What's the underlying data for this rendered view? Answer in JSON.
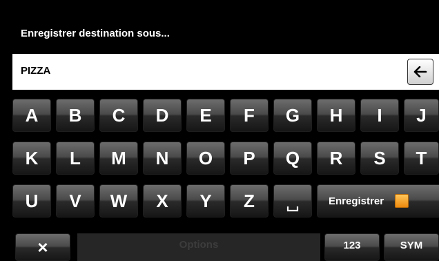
{
  "header": {
    "title": "Enregistrer destination sous..."
  },
  "input": {
    "value": "PIZZA",
    "backspace_icon": "arrow-left-icon"
  },
  "keyboard": {
    "row1": [
      "A",
      "B",
      "C",
      "D",
      "E",
      "F",
      "G",
      "H",
      "I",
      "J"
    ],
    "row2": [
      "K",
      "L",
      "M",
      "N",
      "O",
      "P",
      "Q",
      "R",
      "S",
      "T"
    ],
    "row3": [
      "U",
      "V",
      "W",
      "X",
      "Y",
      "Z"
    ],
    "space_key_icon": "space-bar-icon",
    "save_label": "Enregistrer",
    "save_icon": "save-icon"
  },
  "bottom_bar": {
    "close_label": "×",
    "options_label": "Options",
    "numbers_label": "123",
    "symbols_label": "SYM"
  },
  "colors": {
    "background": "#000000",
    "key_top": "#6d6d6d",
    "key_bottom": "#161616",
    "save_icon_orange": "#f39a1e",
    "options_disabled_text": "#3c3c3c"
  }
}
